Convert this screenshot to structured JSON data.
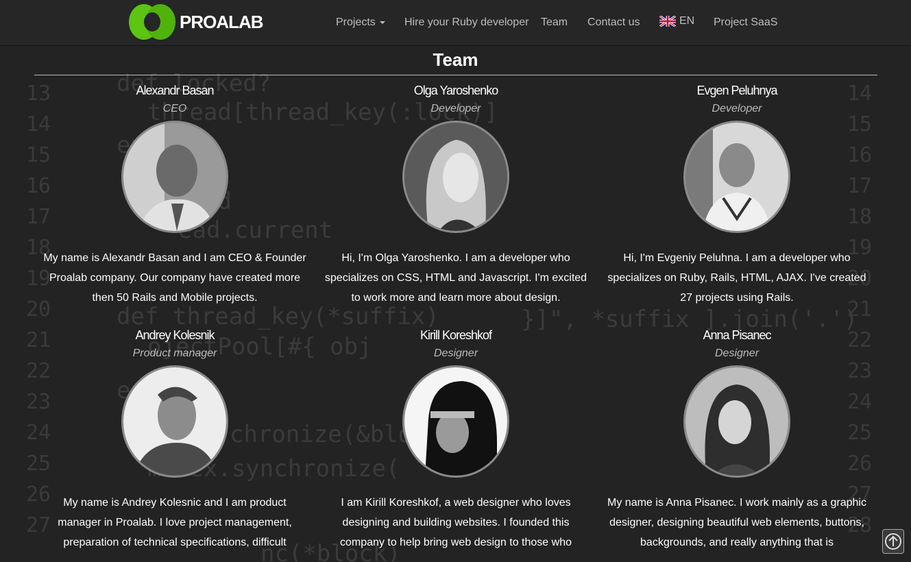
{
  "brand": {
    "name": "PROALAB",
    "logo_icon": "proalab-logo-icon",
    "accent": "#5cc413"
  },
  "nav": {
    "projects": "Projects",
    "hire": "Hire your Ruby developer",
    "team": "Team",
    "contact": "Contact us",
    "lang": "EN",
    "saas": "Project SaaS"
  },
  "page": {
    "title": "Team"
  },
  "members": [
    {
      "name": "Alexandr Basan",
      "role": "CEO",
      "bio": "My name is Alexandr Basan and I am CEO & Founder Proalab company. Our company have created more then 50 Rails and Mobile projects."
    },
    {
      "name": "Olga Yaroshenko",
      "role": "Developer",
      "bio": "Hi, I'm Olga Yaroshenko. I am a developer who specializes on CSS, HTML and Javascript. I'm excited to work more and learn more about design."
    },
    {
      "name": "Evgen Peluhnya",
      "role": "Developer",
      "bio": "Hi, I'm Evgeniy Peluhna. I am a developer who specializes on Ruby, Rails, HTML, AJAX. I've created 27 projects using Rails."
    },
    {
      "name": "Andrey Kolesnik",
      "role": "Product manager",
      "bio": "My name is Andrey Kolesnic and I am product manager in Proalab. I love project management, preparation of technical specifications, difficult"
    },
    {
      "name": "Kirill Koreshkof",
      "role": "Designer",
      "bio": "I am Kirill Koreshkof, a web designer who loves designing and building websites. I founded this company to help bring web design to those who"
    },
    {
      "name": "Anna Pisanec",
      "role": "Designer",
      "bio": "My name is Anna Pisanec. I work mainly as a graphic designer, designing beautiful web elements, buttons, backgrounds, and really anything that is"
    }
  ],
  "background": {
    "left_numbers": [
      "13",
      "14",
      "15",
      "16",
      "17",
      "18",
      "19",
      "20",
      "21",
      "22",
      "23",
      "24",
      "25",
      "26",
      "27"
    ],
    "right_numbers": [
      "14",
      "15",
      "16",
      "17",
      "18",
      "19",
      "20",
      "21",
      "22",
      "23",
      "24",
      "25",
      "26",
      "27",
      "28"
    ],
    "snippets": [
      "def locked?",
      "thread[thread_key(:lock)]",
      "end",
      "thread",
      "ead.current",
      "def thread_key(*suffix)",
      "ojectPool[#{ obj",
      "}]\", *suffix ].join('.')",
      "end",
      "chronize(&bloc",
      "mutex.synchronize(",
      "nc(*block)"
    ]
  }
}
